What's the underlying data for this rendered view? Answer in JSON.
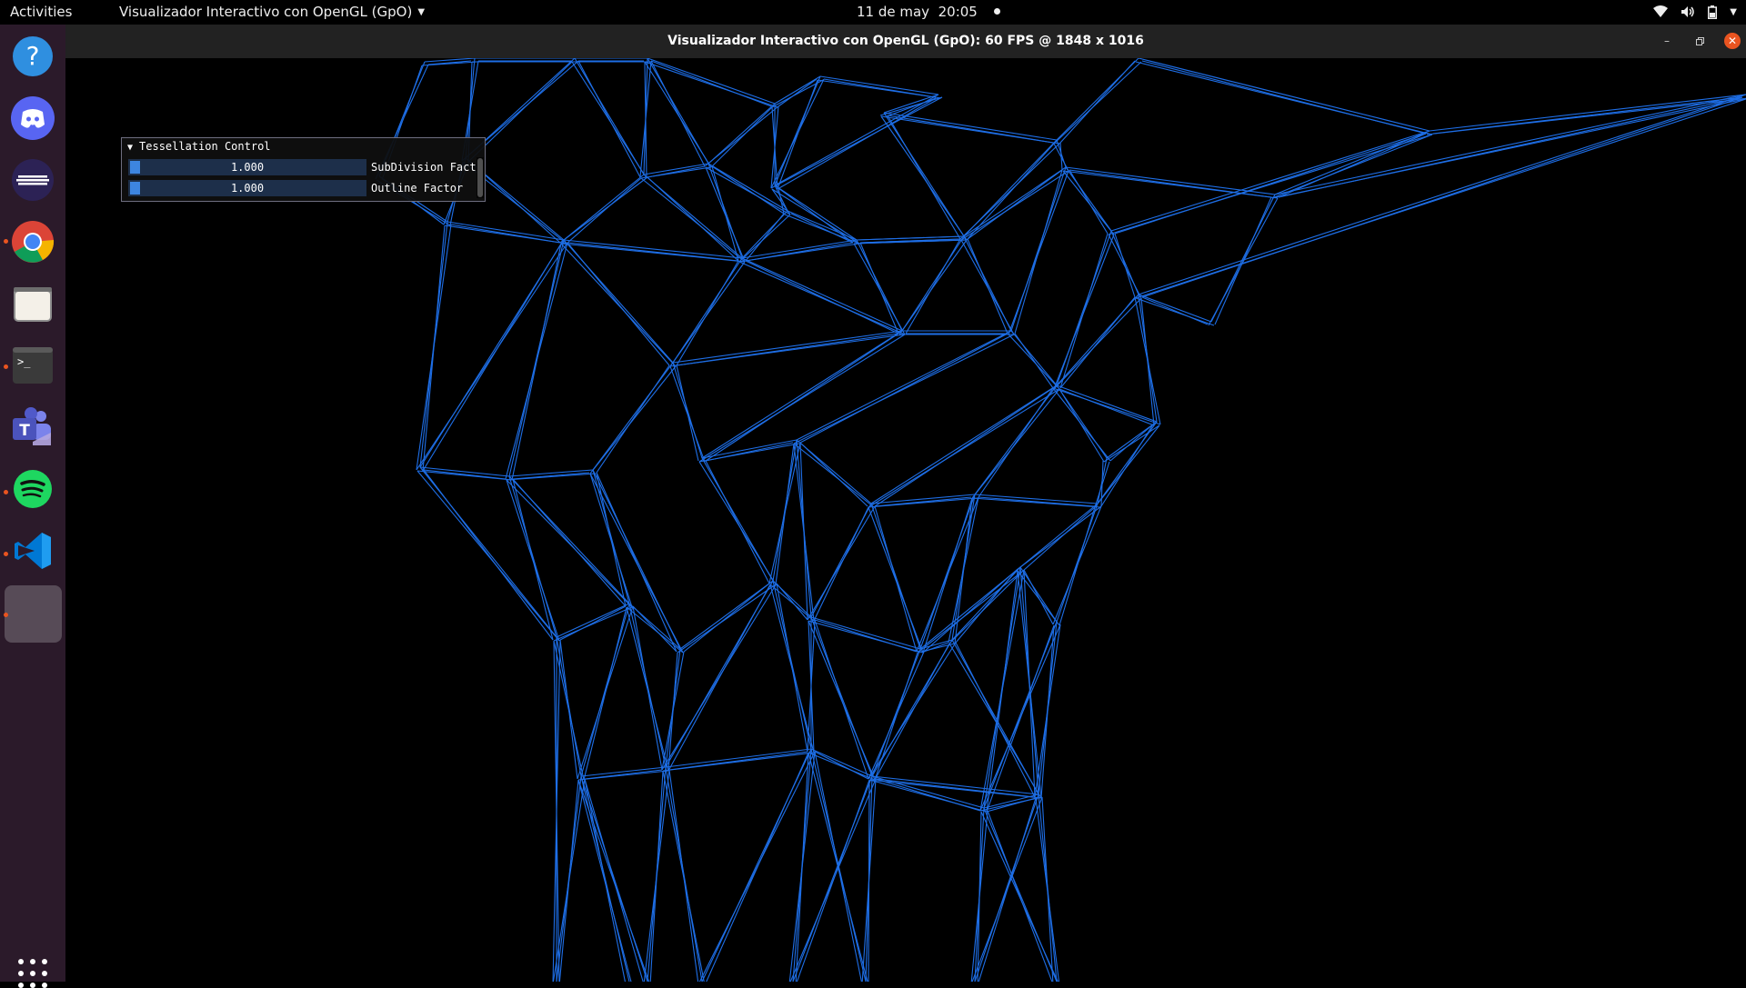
{
  "topbar": {
    "activities": "Activities",
    "app_menu": "Visualizador Interactivo con OpenGL (GpO)",
    "date": "11 de may",
    "time": "20:05"
  },
  "dock": {
    "items": [
      {
        "name": "help-icon",
        "running": false
      },
      {
        "name": "discord-icon",
        "running": false
      },
      {
        "name": "eclipse-icon",
        "running": false
      },
      {
        "name": "chrome-icon",
        "running": true
      },
      {
        "name": "files-icon",
        "running": false
      },
      {
        "name": "terminal-icon",
        "running": true
      },
      {
        "name": "teams-icon",
        "running": false
      },
      {
        "name": "spotify-icon",
        "running": true
      },
      {
        "name": "vscode-icon",
        "running": true
      },
      {
        "name": "opengl-app-icon",
        "running": true,
        "active": true
      }
    ],
    "show_apps": "apps-grid-icon"
  },
  "window": {
    "title": "Visualizador Interactivo con OpenGL (GpO):  60 FPS @ 1848 x 1016"
  },
  "imgui": {
    "header": "Tessellation Control",
    "sliders": [
      {
        "value": "1.000",
        "label": "SubDivision Fact"
      },
      {
        "value": "1.000",
        "label": "Outline Factor"
      }
    ]
  },
  "colors": {
    "wire": "#1e6ee6",
    "accent": "#e95420",
    "dock_bg": "#2b1a2a",
    "slider_frame": "#1d2f4a",
    "slider_grab": "#3d85e0"
  }
}
